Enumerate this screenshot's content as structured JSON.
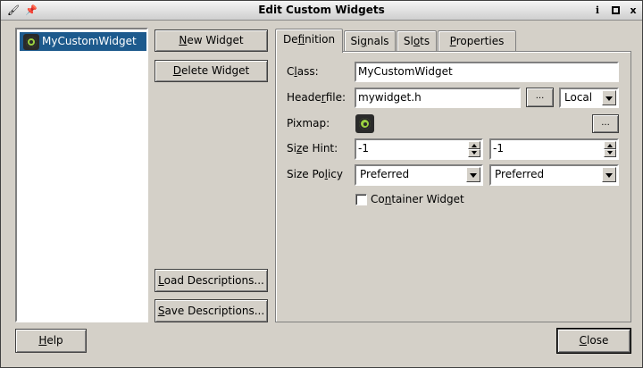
{
  "window": {
    "title": "Edit Custom Widgets",
    "help_glyph": "i",
    "close_glyph": "x"
  },
  "widget_list": {
    "items": [
      {
        "label": "MyCustomWidget",
        "icon": "qt-logo-icon",
        "selected": true
      }
    ]
  },
  "buttons": {
    "new_widget": {
      "accel": "N",
      "rest": "ew Widget"
    },
    "delete_widget": {
      "accel": "D",
      "rest": "elete Widget"
    },
    "load_descriptions": {
      "accel": "L",
      "rest": "oad Descriptions..."
    },
    "save_descriptions": {
      "accel": "S",
      "rest": "ave Descriptions..."
    },
    "help": {
      "accel": "H",
      "rest": "elp"
    },
    "close": {
      "accel": "C",
      "rest": "lose"
    }
  },
  "tabs": [
    {
      "pre": "De",
      "accel": "f",
      "post": "inition",
      "active": true
    },
    {
      "pre": "Si",
      "accel": "g",
      "post": "nals",
      "active": false
    },
    {
      "pre": "Sl",
      "accel": "o",
      "post": "ts",
      "active": false
    },
    {
      "pre": "",
      "accel": "P",
      "post": "roperties",
      "active": false
    }
  ],
  "definition": {
    "class_label": {
      "pre": "C",
      "accel": "l",
      "post": "ass:"
    },
    "class_value": "MyCustomWidget",
    "headerfile_label": {
      "pre": "Heade",
      "accel": "r",
      "post": "file:"
    },
    "headerfile_value": "mywidget.h",
    "browse_label": "...",
    "include_scope": "Local",
    "pixmap_label": "Pixmap:",
    "size_hint_label": {
      "pre": "Si",
      "accel": "z",
      "post": "e Hint:"
    },
    "size_hint_width": "-1",
    "size_hint_height": "-1",
    "size_policy_label": {
      "pre": "Size Po",
      "accel": "l",
      "post": "icy"
    },
    "size_policy_horizontal": "Preferred",
    "size_policy_vertical": "Preferred",
    "container_label": {
      "pre": "Co",
      "accel": "n",
      "post": "tainer Widget"
    },
    "container_checked": false
  },
  "colors": {
    "selection": "#1d5a8d",
    "window_bg": "#d4d0c8",
    "qt_green": "#9bd140"
  }
}
